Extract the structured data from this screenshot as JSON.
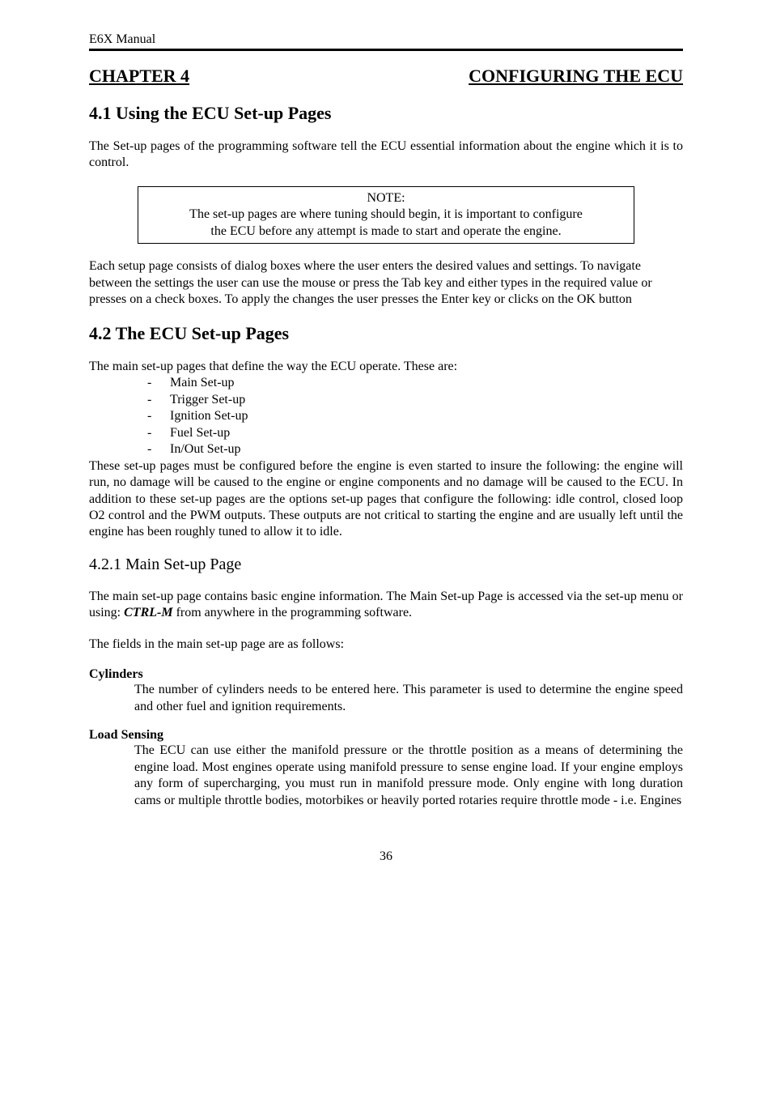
{
  "header": {
    "left": "E6X Manual",
    "right": ""
  },
  "chapter": {
    "label": "CHAPTER 4",
    "title": "CONFIGURING THE ECU"
  },
  "sec41": {
    "heading": "4.1 Using the ECU Set-up Pages",
    "p1": "The Set-up pages of the programming software tell the ECU essential information about the engine which it is to control.",
    "note": {
      "title": "NOTE:",
      "line1": "The set-up pages are where tuning should begin, it is important to configure",
      "line2": "the ECU before any attempt is made to start and operate the engine."
    },
    "p2": "Each setup page consists of dialog boxes where the user enters the desired values and settings. To navigate between the settings the user can use the mouse or press the Tab key and either types in the required value or presses on a check boxes. To apply the changes the user presses the Enter key or clicks on the OK button"
  },
  "sec42": {
    "heading": "4.2 The ECU Set-up Pages",
    "intro": "The main set-up pages that define the way the ECU operate. These are:",
    "bullets": [
      "Main Set-up",
      "Trigger Set-up",
      "Ignition Set-up",
      "Fuel Set-up",
      "In/Out Set-up"
    ],
    "p1": "These set-up pages must be configured before the engine is even started to insure the following: the engine will run, no damage will be caused to the engine or engine components and no damage will be caused to the ECU.  In addition to these set-up pages are the options set-up pages that configure the following: idle control, closed loop O2 control and the PWM outputs.  These outputs are not critical to starting the engine and are usually left until the engine has been roughly tuned to allow it to idle."
  },
  "sec421": {
    "heading": "4.2.1 Main Set-up Page",
    "p1_a": "The main set-up page contains basic engine information.  The Main Set-up Page is accessed via the set-up menu or using: ",
    "p1_b": "CTRL-M",
    "p1_c": " from anywhere in the programming software.",
    "p2": "The fields in the main set-up page are as follows:",
    "cylinders": {
      "term": "Cylinders",
      "defn": "The number of cylinders needs to be entered here. This parameter is used to determine the engine speed and other fuel and ignition requirements."
    },
    "load": {
      "term": "Load Sensing",
      "defn": "The ECU can use either the manifold pressure or the throttle position as a means of determining the engine load.  Most engines operate using manifold pressure to sense engine load. If your engine employs any form of supercharging, you must run in manifold pressure mode.  Only engine with long duration cams or multiple throttle bodies, motorbikes or heavily ported rotaries require throttle mode - i.e. Engines"
    }
  },
  "pageNumber": "36"
}
